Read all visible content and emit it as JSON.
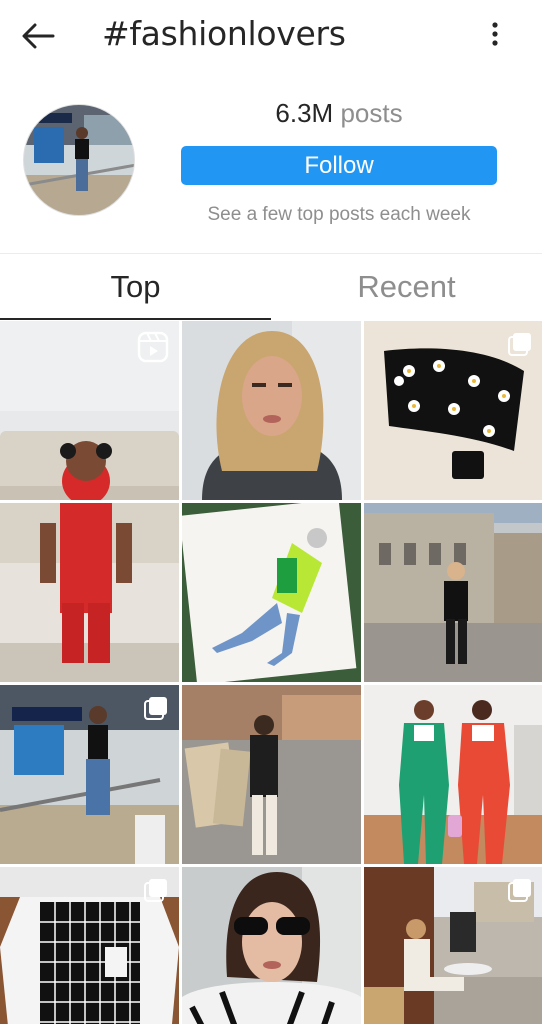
{
  "header": {
    "title": "#fashionlovers",
    "back_icon": "arrow-left-icon",
    "more_icon": "vertical-dots-icon"
  },
  "hashtag": {
    "posts_count": "6.3M",
    "posts_word": "posts",
    "follow_label": "Follow",
    "note": "See a few top posts each week",
    "accent_color": "#2196f3"
  },
  "tabs": [
    {
      "label": "Top",
      "active": true
    },
    {
      "label": "Recent",
      "active": false
    }
  ],
  "grid": {
    "tiles": [
      {
        "subject": "toddler in red outfit",
        "badge": "reels-icon"
      },
      {
        "subject": "woman with long blonde hair",
        "badge": ""
      },
      {
        "subject": "black bustier top with daisies",
        "badge": "carousel-icon"
      },
      {
        "subject": "fashion illustration neon jacket",
        "badge": ""
      },
      {
        "subject": "woman in black on cobblestone street",
        "badge": ""
      },
      {
        "subject": "woman in black top at mall",
        "badge": "carousel-icon"
      },
      {
        "subject": "woman in black leather jacket old town",
        "badge": ""
      },
      {
        "subject": "two women in green and red suits",
        "badge": ""
      },
      {
        "subject": "checkered shirt flat lay",
        "badge": "carousel-icon"
      },
      {
        "subject": "woman with sunglasses zebra top",
        "badge": ""
      },
      {
        "subject": "woman seated at street cafe",
        "badge": "carousel-icon"
      }
    ]
  }
}
